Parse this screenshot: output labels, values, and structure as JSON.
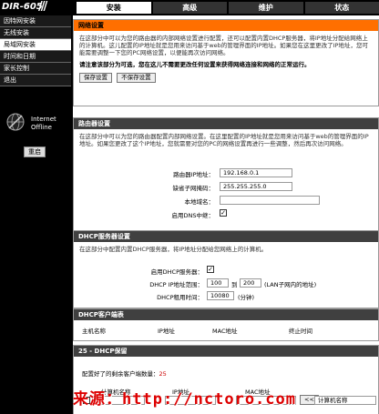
{
  "header": {
    "logo": "DIR-605",
    "tabs": [
      "安装",
      "高级",
      "维护",
      "状态"
    ]
  },
  "sidebar": {
    "items": [
      "因特网安装",
      "无线安装",
      "局域网安装",
      "时间和日期",
      "家长控制",
      "退出"
    ],
    "active_index": 2,
    "internet_label": "Internet",
    "internet_status": "Offline",
    "reboot_label": "重启"
  },
  "network": {
    "title": "网络设置",
    "intro": "在这部分中可以为您的路由器的内部网络设置进行配置，还可以配置内置DHCP服务器，将IP地址分配给网络上的计算机。这儿配置的IP地址就是您用来访问基于web的管理界面的IP地址。如果您在这里更改了IP地址，您可能需要调整一下您的PC网络设置，以便能再次访问网络。",
    "notice": "请注意该部分为可选，您在这儿不需要更改任何设置来获得网络连接和网络的正常运行。",
    "save_label": "保存设置",
    "nosave_label": "不保存设置"
  },
  "router": {
    "title": "路由器设置",
    "intro": "在这部分中可以为您的路由器配置内部网络设置。在这里配置的IP地址就是您用来访问基于web的管理界面的IP地址。如果您更改了这个IP地址，您就需要对您的PC的网络设置再进行一些调整，然后再次访问网络。",
    "ip_label": "路由器IP地址：",
    "ip_value": "192.168.0.1",
    "mask_label": "缺省子网掩码：",
    "mask_value": "255.255.255.0",
    "domain_label": "本地域名：",
    "domain_value": "",
    "dns_label": "启用DNS中继：",
    "dns_checked": "✓"
  },
  "dhcp": {
    "title": "DHCP服务器设置",
    "intro": "在这部分中配置内置DHCP服务器，将IP地址分配给您网络上的计算机。",
    "enable_label": "启用DHCP服务器：",
    "enable_checked": "✓",
    "range_label": "DHCP IP地址范围：",
    "range_start": "100",
    "range_to": "到",
    "range_end": "200",
    "range_note": "(LAN子网内的地址)",
    "lease_label": "DHCP租用时间：",
    "lease_value": "10080",
    "lease_unit": "(分钟)"
  },
  "clients": {
    "title": "DHCP客户端表",
    "columns": [
      "主机名称",
      "IP地址",
      "MAC地址",
      "终止时间"
    ]
  },
  "reserve": {
    "title": "25 - DHCP保留",
    "remaining_label": "配置好了的剩余客户端数量：",
    "remaining_value": "25",
    "columns": [
      "计算机名称",
      "IP地址",
      "MAC地址"
    ],
    "row_right": "计算机名称",
    "copy_label": "<<"
  },
  "watermark": "来源：http://nctoro.com"
}
